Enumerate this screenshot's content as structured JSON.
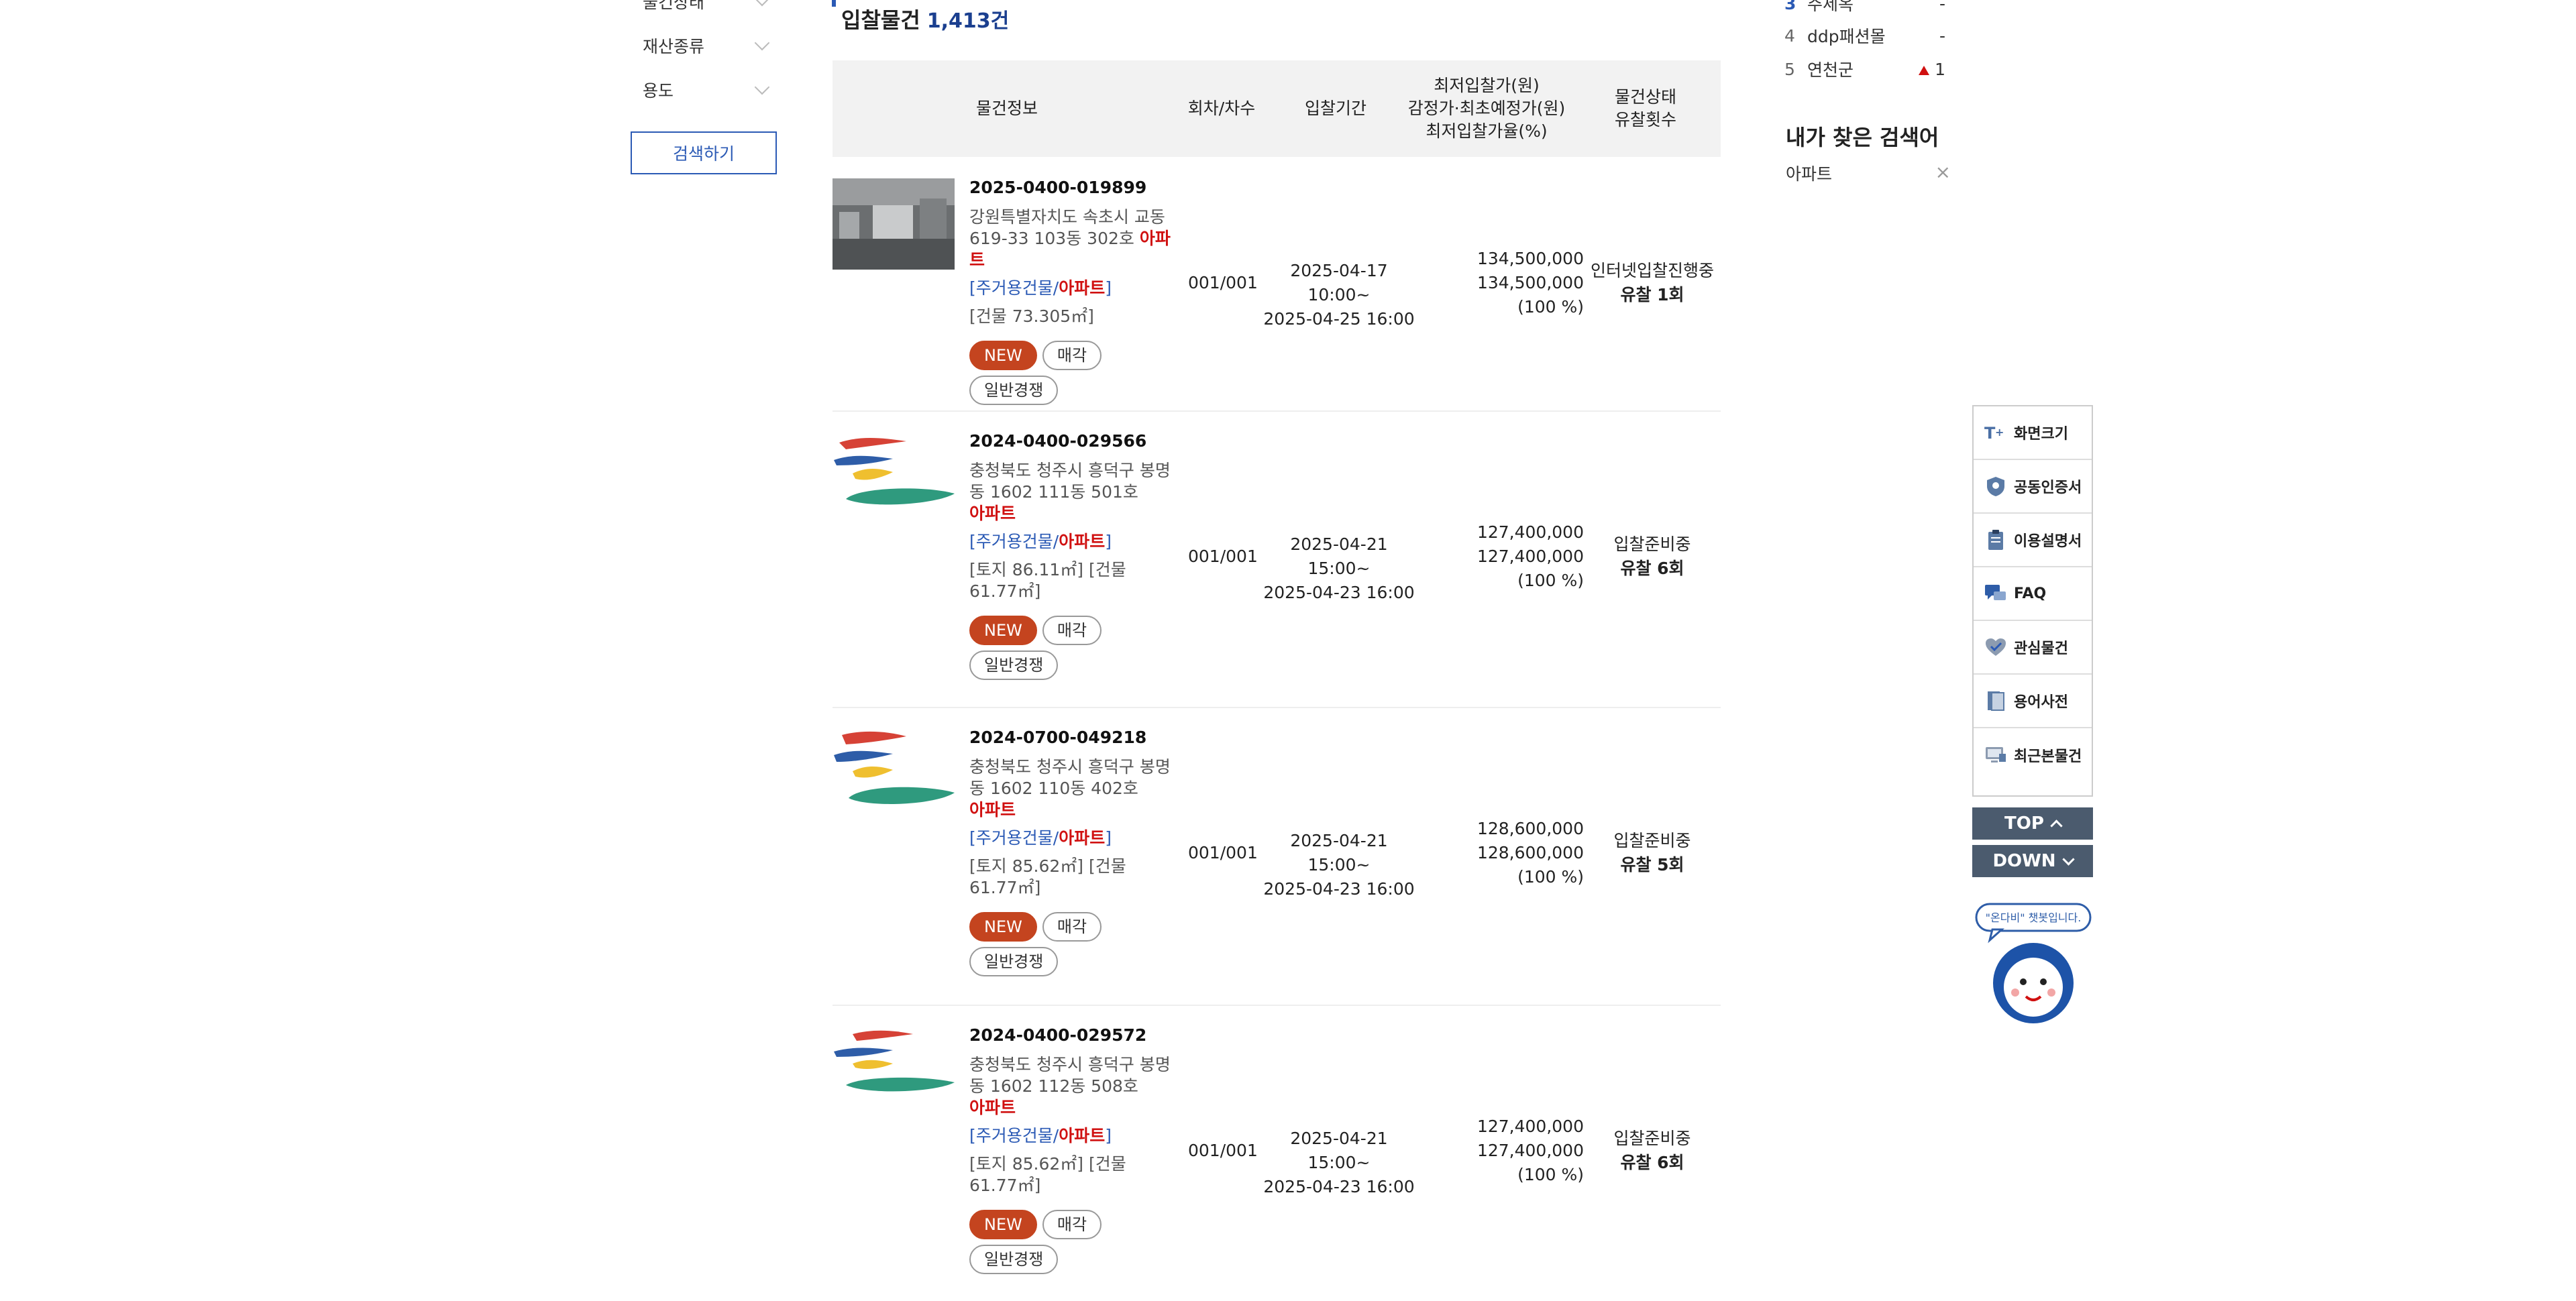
{
  "sidebar": {
    "filters": [
      {
        "label": "물건상태"
      },
      {
        "label": "재산종류"
      },
      {
        "label": "용도"
      }
    ],
    "search_button": "검색하기"
  },
  "main": {
    "title": "입찰물건",
    "count": "1,413건",
    "headers": {
      "info": "물건정보",
      "round": "회차/차수",
      "period": "입찰기간",
      "price_l1": "최저입찰가(원)",
      "price_l2": "감정가·최초예정가(원)",
      "price_l3": "최저입찰가율(%)",
      "status_l1": "물건상태",
      "status_l2": "유찰횟수"
    },
    "items": [
      {
        "case_no": "2025-0400-019899",
        "addr": "강원특별자치도 속초시 교동 619-33 103동 302호",
        "addr_apt": "아파트",
        "cat_prefix": "[주거용건물/",
        "cat_apt": "아파트",
        "cat_suffix": "]",
        "area": "[건물 73.305㎡]",
        "tags": [
          "NEW",
          "매각",
          "일반경쟁"
        ],
        "round": "001/001",
        "period_start": "2025-04-17 10:00~",
        "period_end": "2025-04-25 16:00",
        "min_price": "134,500,000",
        "appraisal": "134,500,000",
        "rate": "(100 %)",
        "status": "인터넷입찰진행중",
        "fail_count": "유찰 1회"
      },
      {
        "case_no": "2024-0400-029566",
        "addr": "충청북도 청주시 흥덕구 봉명동 1602 111동 501호",
        "addr_apt": "아파트",
        "cat_prefix": "[주거용건물/",
        "cat_apt": "아파트",
        "cat_suffix": "]",
        "area": "[토지 86.11㎡] [건물 61.77㎡]",
        "tags": [
          "NEW",
          "매각",
          "일반경쟁"
        ],
        "round": "001/001",
        "period_start": "2025-04-21 15:00~",
        "period_end": "2025-04-23 16:00",
        "min_price": "127,400,000",
        "appraisal": "127,400,000",
        "rate": "(100 %)",
        "status": "입찰준비중",
        "fail_count": "유찰 6회"
      },
      {
        "case_no": "2024-0700-049218",
        "addr": "충청북도 청주시 흥덕구 봉명동 1602 110동 402호",
        "addr_apt": "아파트",
        "cat_prefix": "[주거용건물/",
        "cat_apt": "아파트",
        "cat_suffix": "]",
        "area": "[토지 85.62㎡] [건물 61.77㎡]",
        "tags": [
          "NEW",
          "매각",
          "일반경쟁"
        ],
        "round": "001/001",
        "period_start": "2025-04-21 15:00~",
        "period_end": "2025-04-23 16:00",
        "min_price": "128,600,000",
        "appraisal": "128,600,000",
        "rate": "(100 %)",
        "status": "입찰준비중",
        "fail_count": "유찰 5회"
      },
      {
        "case_no": "2024-0400-029572",
        "addr": "충청북도 청주시 흥덕구 봉명동 1602 112동 508호",
        "addr_apt": "아파트",
        "cat_prefix": "[주거용건물/",
        "cat_apt": "아파트",
        "cat_suffix": "]",
        "area": "[토지 85.62㎡] [건물 61.77㎡]",
        "tags": [
          "NEW",
          "매각",
          "일반경쟁"
        ],
        "round": "001/001",
        "period_start": "2025-04-21 15:00~",
        "period_end": "2025-04-23 16:00",
        "min_price": "127,400,000",
        "appraisal": "127,400,000",
        "rate": "(100 %)",
        "status": "입찰준비중",
        "fail_count": "유찰 6회"
      }
    ]
  },
  "popular": {
    "items": [
      {
        "rank": "3",
        "name": "주세옥",
        "change": "-"
      },
      {
        "rank": "4",
        "name": "ddp패션몰",
        "change": "-"
      },
      {
        "rank": "5",
        "name": "연천군",
        "change": "1",
        "direction": "up"
      }
    ]
  },
  "recent_search": {
    "title": "내가 찾은 검색어",
    "items": [
      {
        "text": "아파트",
        "remove": "×"
      }
    ]
  },
  "quick_menu": {
    "items": [
      {
        "label": "화면크기",
        "icon": "font-size-icon"
      },
      {
        "label": "공동인증서",
        "icon": "shield-cert-icon"
      },
      {
        "label": "이용설명서",
        "icon": "clipboard-icon"
      },
      {
        "label": "FAQ",
        "icon": "chat-bubbles-icon"
      },
      {
        "label": "관심물건",
        "icon": "heart-check-icon"
      },
      {
        "label": "용어사전",
        "icon": "book-icon"
      },
      {
        "label": "최근본물건",
        "icon": "monitor-icon"
      }
    ],
    "top": "TOP",
    "down": "DOWN"
  },
  "chatbot": {
    "bubble": "\"온다비\" 챗봇입니다."
  },
  "colors": {
    "accent": "#2b5ab5",
    "new_tag": "#c4441f",
    "apt_red": "#d01010",
    "nav_btn": "#4b5b6e"
  }
}
